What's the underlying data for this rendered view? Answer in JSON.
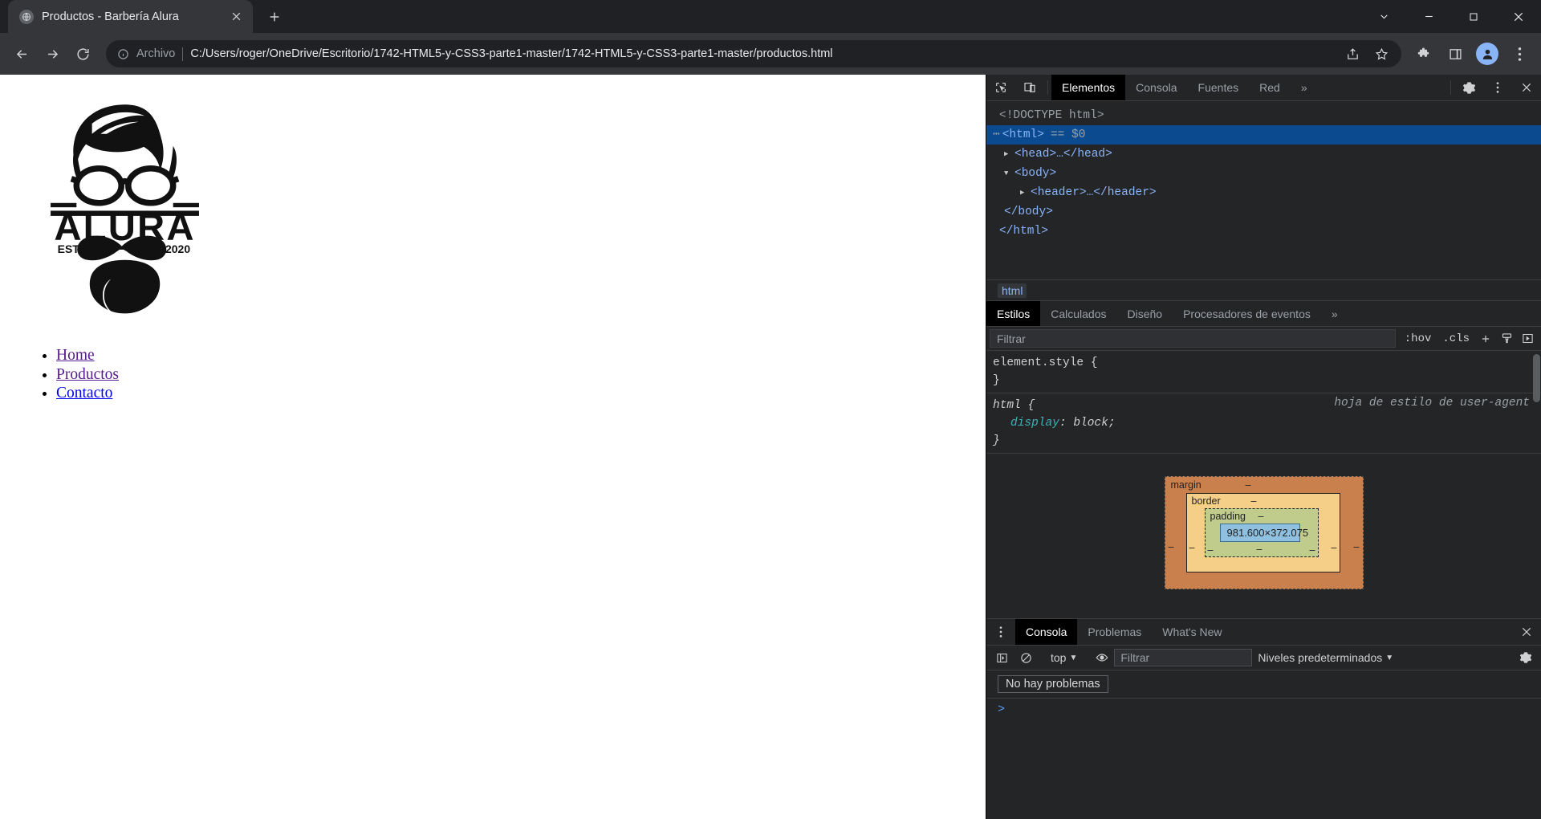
{
  "browser": {
    "tab": {
      "title": "Productos - Barbería Alura",
      "favicon_icon": "globe-icon",
      "close_icon": "close-icon"
    },
    "new_tab_label": "+",
    "window_controls": {
      "minimize_to_tray_icon": "chevron-down-icon",
      "minimize_icon": "minimize-icon",
      "maximize_icon": "maximize-icon",
      "close_icon": "close-icon"
    },
    "toolbar": {
      "back_icon": "back-arrow-icon",
      "forward_icon": "forward-arrow-icon",
      "reload_icon": "reload-icon",
      "info_icon": "info-circle-icon",
      "scheme_label": "Archivo",
      "url": "C:/Users/roger/OneDrive/Escritorio/1742-HTML5-y-CSS3-parte1-master/1742-HTML5-y-CSS3-parte1-master/productos.html",
      "share_icon": "share-icon",
      "bookmark_icon": "star-icon",
      "extensions_icon": "puzzle-piece-icon",
      "side_panel_icon": "side-panel-icon",
      "profile_icon": "user-avatar-icon",
      "menu_icon": "three-dots-vertical-icon"
    }
  },
  "page": {
    "logo": {
      "brand": "ALURA",
      "established_label": "ESTD",
      "established_year": "2020",
      "alt": "Barbería Alura logo"
    },
    "nav": {
      "items": [
        {
          "label": "Home",
          "state": "visited"
        },
        {
          "label": "Productos",
          "state": "visited"
        },
        {
          "label": "Contacto",
          "state": "unvisited"
        }
      ]
    },
    "link_colors": {
      "visited": "#551a8b",
      "unvisited": "#0000ee"
    }
  },
  "devtools": {
    "toolbar": {
      "inspect_icon": "inspect-element-icon",
      "device_toolbar_icon": "device-toggle-icon",
      "settings_icon": "gear-icon",
      "more_icon": "three-dots-vertical-icon",
      "close_icon": "close-icon",
      "overflow_icon": "chevron-double-right-icon"
    },
    "tabs": [
      {
        "label": "Elementos",
        "active": true
      },
      {
        "label": "Consola",
        "active": false
      },
      {
        "label": "Fuentes",
        "active": false
      },
      {
        "label": "Red",
        "active": false
      }
    ],
    "dom": [
      {
        "text": "<!DOCTYPE html>",
        "indent": 0,
        "type": "doctype",
        "selected": false
      },
      {
        "text": "<html>",
        "indent": 0,
        "type": "tag",
        "selected": true,
        "suffix": "== $0",
        "dots": true
      },
      {
        "text": "<head>…</head>",
        "indent": 1,
        "type": "tag",
        "selected": false,
        "arrow": "collapsed"
      },
      {
        "text": "<body>",
        "indent": 1,
        "type": "tag",
        "selected": false,
        "arrow": "expanded"
      },
      {
        "text": "<header>…</header>",
        "indent": 2,
        "type": "tag",
        "selected": false,
        "arrow": "collapsed"
      },
      {
        "text": "</body>",
        "indent": 1,
        "type": "tag",
        "selected": false
      },
      {
        "text": "</html>",
        "indent": 0,
        "type": "tag",
        "selected": false
      }
    ],
    "breadcrumb": [
      "html"
    ],
    "styles": {
      "tabs": [
        {
          "label": "Estilos",
          "active": true
        },
        {
          "label": "Calculados",
          "active": false
        },
        {
          "label": "Diseño",
          "active": false
        },
        {
          "label": "Procesadores de eventos",
          "active": false
        }
      ],
      "overflow_icon": "chevron-double-right-icon",
      "filter_placeholder": "Filtrar",
      "hov_label": ":hov",
      "cls_label": ".cls",
      "new_rule_icon": "plus-icon",
      "class_style_icon": "paint-brush-icon",
      "toggle_sidebar_icon": "collapse-panel-icon",
      "rules": [
        {
          "selector": "element.style",
          "origin": "",
          "declarations": []
        },
        {
          "selector": "html",
          "origin": "hoja de estilo de user-agent",
          "declarations": [
            {
              "property": "display",
              "value": "block"
            }
          ]
        }
      ],
      "box_model": {
        "margin_label": "margin",
        "border_label": "border",
        "padding_label": "padding",
        "content_size": "981.600×372.075",
        "dash": "–",
        "colors": {
          "margin": "#c9804c",
          "border": "#f5cf87",
          "padding": "#bfcc8c",
          "content": "#8fc0e0"
        }
      }
    },
    "drawer": {
      "more_icon": "three-dots-vertical-icon",
      "close_icon": "close-icon",
      "tabs": [
        {
          "label": "Consola",
          "active": true
        },
        {
          "label": "Problemas",
          "active": false
        },
        {
          "label": "What's New",
          "active": false
        }
      ],
      "console_toolbar": {
        "sidebar_icon": "console-sidebar-icon",
        "clear_icon": "clear-console-icon",
        "context_label": "top",
        "context_caret": "▼",
        "eye_icon": "eye-icon",
        "filter_placeholder": "Filtrar",
        "levels_label": "Niveles predeterminados",
        "levels_caret": "▼",
        "settings_icon": "gear-icon"
      },
      "issues_message": "No hay problemas",
      "prompt_caret": ">"
    }
  }
}
